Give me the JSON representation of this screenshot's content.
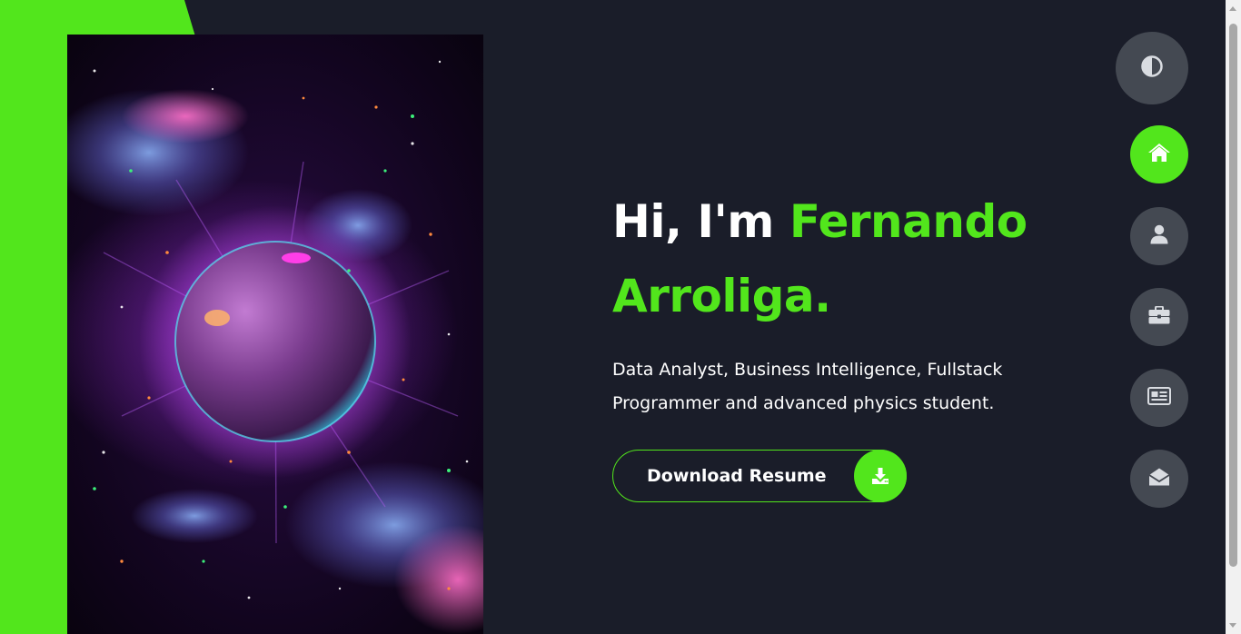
{
  "hero": {
    "greeting": "Hi, I'm ",
    "first_name": "Fernando",
    "last_name": "Arroliga.",
    "tagline": "Data Analyst, Business Intelligence, Fullstack Programmer and advanced physics student.",
    "resume_label": "Download Resume"
  },
  "nav": {
    "theme_icon": "contrast-icon",
    "items": [
      {
        "icon": "home-icon",
        "active": true
      },
      {
        "icon": "user-icon",
        "active": false
      },
      {
        "icon": "briefcase-icon",
        "active": false
      },
      {
        "icon": "newspaper-icon",
        "active": false
      },
      {
        "icon": "envelope-open-icon",
        "active": false
      }
    ]
  },
  "colors": {
    "accent": "#52e61c",
    "background": "#1a1d29",
    "nav_button": "#444952",
    "text": "#ffffff"
  }
}
